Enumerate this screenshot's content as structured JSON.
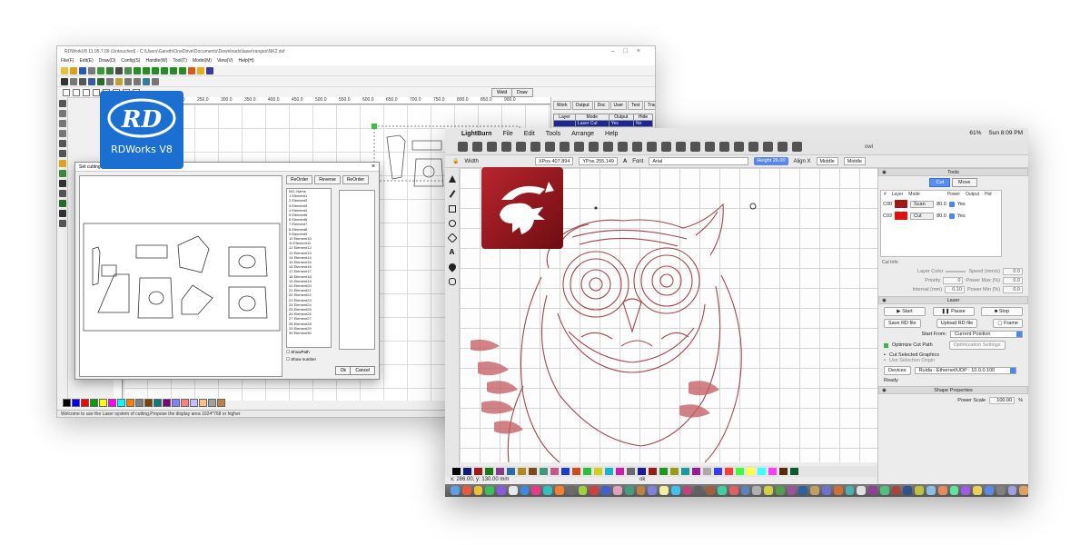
{
  "rdworks": {
    "title_text": "RDWorkV8 11.05.7.09 (Untouched) - C:\\Users\\Gareth\\OneDrive\\Documents\\Downloads\\laser\\ranges\\NK2.dxf",
    "menu": [
      "File(F)",
      "Edit(E)",
      "Draw(D)",
      "Config(S)",
      "Handle(W)",
      "Tool(T)",
      "Model(M)",
      "View(V)",
      "Help(H)"
    ],
    "toolbar_buttons": [
      "Weld",
      "Draw"
    ],
    "ruler_ticks": [
      "100.0",
      "150.0",
      "200.0",
      "250.0",
      "300.0",
      "350.0",
      "400.0",
      "450.0",
      "500.0",
      "550.0",
      "600.0",
      "650.0",
      "700.0",
      "750.0",
      "800.0",
      "850.0",
      "900.0"
    ],
    "vruler_ticks": [
      "300.0",
      "400.0",
      "500.0",
      "600.0",
      "700.0",
      "800.0",
      "900.0"
    ],
    "tabs": [
      "Work",
      "Output",
      "Doc",
      "User",
      "Test",
      "Transform"
    ],
    "layer_table": {
      "headers": [
        "Layer",
        "Mode",
        "Output",
        "Hide"
      ],
      "rows": [
        [
          "",
          "Laser Cut",
          "Yes",
          "No"
        ]
      ]
    },
    "dialog": {
      "title": "Set cutting property",
      "buttons": [
        "ReOrder",
        "Reverse",
        "ReOrder"
      ],
      "list_headers": [
        "NO.",
        "Name"
      ],
      "elements": [
        "Element1",
        "Element2",
        "Element3",
        "Element4",
        "Element5",
        "Element6",
        "Element7",
        "Element8",
        "Element9",
        "Element10",
        "Element11",
        "Element12",
        "Element13",
        "Element14",
        "Element15",
        "Element16",
        "Element17",
        "Element18",
        "Element19",
        "Element20",
        "Element21",
        "Element22",
        "Element23",
        "Element24",
        "Element25",
        "Element26",
        "Element27",
        "Element28",
        "Element29",
        "Element30"
      ],
      "checkbox_1": "ShowPath",
      "checkbox_2": "Show number",
      "ok": "Ok",
      "cancel": "Cancel"
    },
    "status": "Welcome to use the Laser system of cutting,Propose the display area 1024*768 or higher",
    "logo_text": "RDWorks V8",
    "palette": [
      "#000000",
      "#0000ff",
      "#ff0000",
      "#00a000",
      "#ffff00",
      "#ff00ff",
      "#00ffff",
      "#ff8000",
      "#808080",
      "#804000",
      "#008080",
      "#800080",
      "#8080ff",
      "#ff8080",
      "#c0c0ff",
      "#ffc080",
      "#a0a0a0",
      "#c08040"
    ]
  },
  "lightburn": {
    "menu": [
      "LightBurn",
      "File",
      "Edit",
      "Tools",
      "Arrange",
      "Help"
    ],
    "menu_right": [
      "61%",
      "Sun 8:09 PM"
    ],
    "doc_title": "owl",
    "tool_options": {
      "width_label": "Width",
      "xpos": "XPos 407.894",
      "ypos": "YPos 255.149",
      "font_label": "Font",
      "font_value": "Arial",
      "height": "Height 26.00",
      "align_x": "Align X",
      "align_x_value": "Middle",
      "align_y_value": "Middle"
    },
    "cuts_header": "Tools",
    "cut_tab": "Cut",
    "move_tab": "Move",
    "layers_headers": [
      "#",
      "Layer",
      "Mode",
      "Power",
      "Output",
      "Hid"
    ],
    "layers": [
      {
        "id": "C00",
        "color": "#a01818",
        "mode": "Scan",
        "power": "80.0",
        "output": "Yes"
      },
      {
        "id": "C03",
        "color": "#e01010",
        "mode": "Cut",
        "power": "80.0",
        "output": "Yes"
      }
    ],
    "cut_info": "Cut Info",
    "props": [
      {
        "label": "Layer Color",
        "value": "",
        "label2": "Speed (mm/s)",
        "value2": "0.0"
      },
      {
        "label": "Priority",
        "value": "0",
        "label2": "Power Max (%)",
        "value2": "0.0"
      },
      {
        "label": "Interval (mm)",
        "value": "0.10",
        "label2": "Power Min (%)",
        "value2": "0.0"
      }
    ],
    "laser_header": "Laser",
    "start": "Start",
    "pause": "Pause",
    "stop": "Stop",
    "save_rd": "Save RD file",
    "upload_rd": "Upload RD file",
    "frame": "Frame",
    "start_from_label": "Start From:",
    "start_from_value": "Current Position",
    "optimize": "Optimize Cut Path",
    "optimization_settings": "Optimization Settings",
    "cut_selected": "Cut Selected Graphics",
    "use_selection_origin": "Use Selection Origin",
    "devices": "Devices",
    "device_value": "Ruida - Ethernet/UDP : 10.0.0.100",
    "ready": "Ready",
    "shape_properties": "Shape Properties",
    "power_scale_label": "Power Scale",
    "power_scale_value": "100.00",
    "power_scale_unit": "%",
    "coords": "x: 286.00, y: 130.00 mm",
    "status_ok": "ok",
    "palette": [
      "#000000",
      "#0d1f7a",
      "#a01818",
      "#1a7a1a",
      "#8a3c8a",
      "#2a6aa8",
      "#b08a20",
      "#7a4a1a",
      "#3a9a7a",
      "#c05a8a",
      "#1a3ad0",
      "#d04a1a",
      "#2ac03a",
      "#d0d01a",
      "#1ab0d0",
      "#d01ab0",
      "#6a6a6a",
      "#1a1a9a",
      "#9a1a1a",
      "#1a9a1a",
      "#9a9a1a",
      "#1a9a9a",
      "#9a1a9a",
      "#aaaaaa",
      "#3a3aff",
      "#ff3a3a",
      "#3aff3a",
      "#ffff3a",
      "#3affff",
      "#ff3aff",
      "#5a2a0a",
      "#0a5a2a"
    ]
  }
}
